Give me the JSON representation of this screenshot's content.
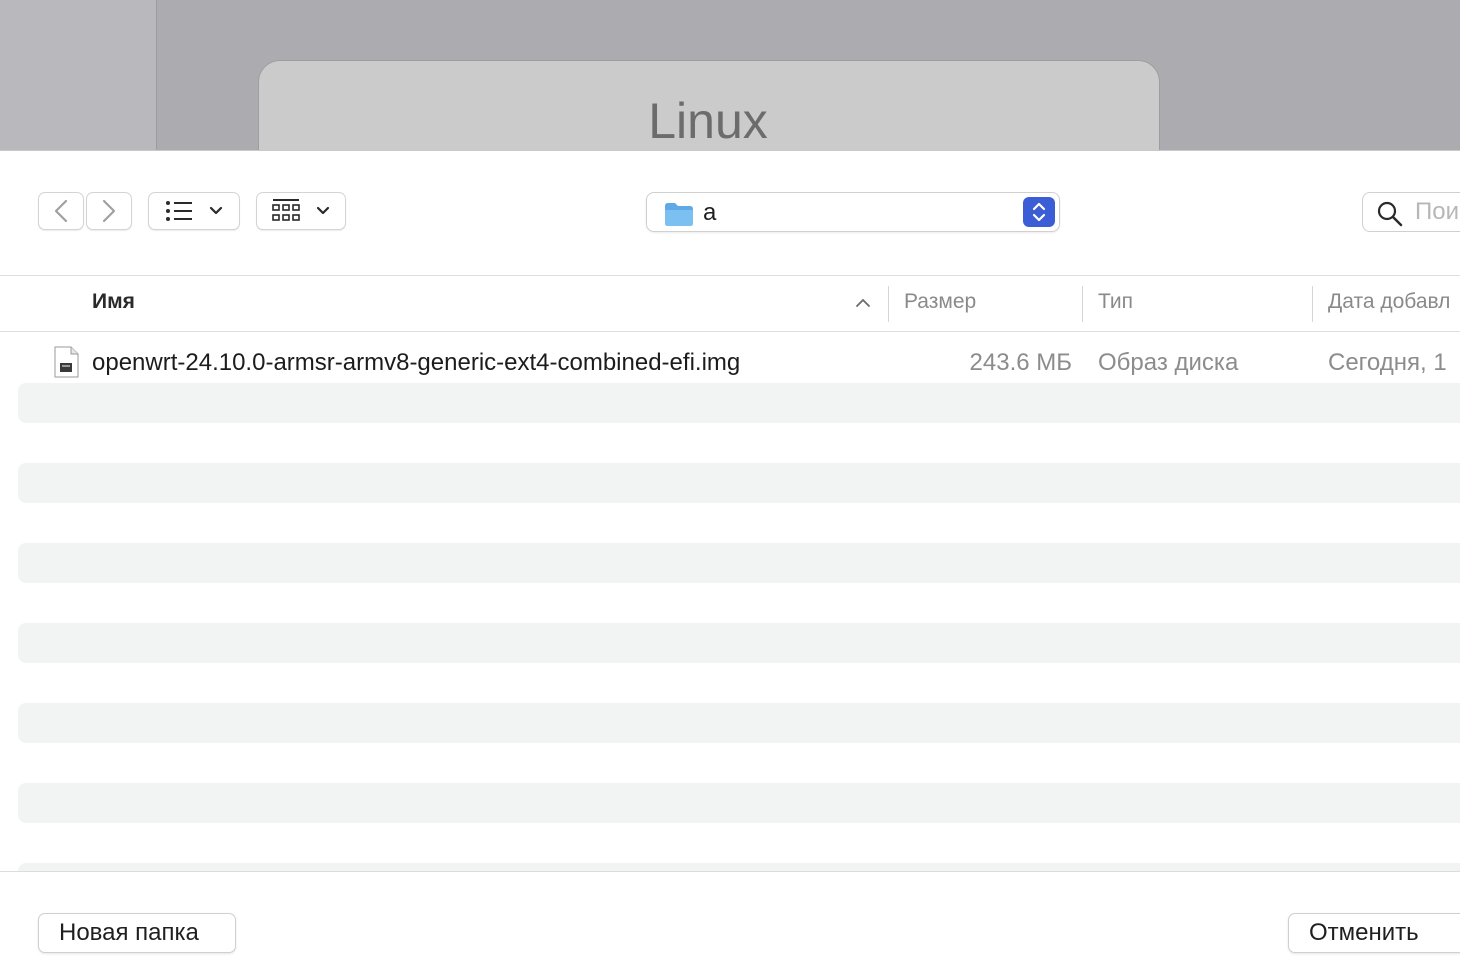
{
  "background": {
    "card_title": "Linux"
  },
  "toolbar": {
    "back_icon": "chevron-left-icon",
    "forward_icon": "chevron-right-icon",
    "view_icon": "list-view-icon",
    "group_icon": "grid-group-icon",
    "location": "a",
    "location_icon": "folder-icon",
    "search_placeholder": "Пои"
  },
  "table": {
    "columns": [
      "Имя",
      "Размер",
      "Тип",
      "Дата добавл"
    ],
    "sorted_column": "Имя",
    "sort_direction": "ascending",
    "rows": [
      {
        "name": "openwrt-24.10.0-armsr-armv8-generic-ext4-combined-efi.img",
        "size": "243.6 МБ",
        "type": "Образ диска",
        "date_added": "Сегодня, 1"
      }
    ]
  },
  "buttons": {
    "new_folder": "Новая папка",
    "cancel": "Отменить"
  },
  "colors": {
    "accent": "#3b5ed6",
    "folder": "#6fb7f0",
    "stripe": "#f2f3f3"
  }
}
